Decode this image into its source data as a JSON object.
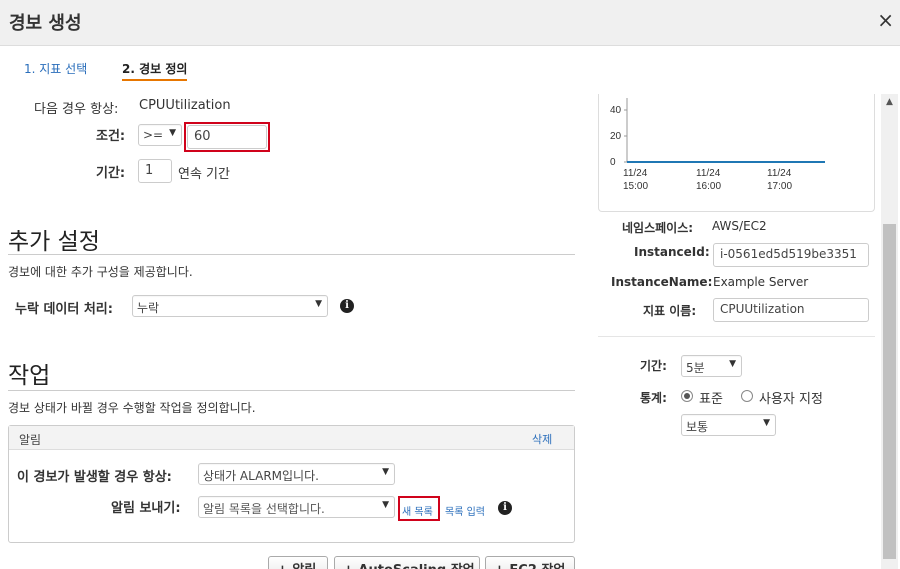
{
  "dialog": {
    "title": "경보 생성",
    "close": "×"
  },
  "steps": [
    {
      "label": "1. 지표 선택"
    },
    {
      "label": "2. 경보 정의"
    }
  ],
  "alarm": {
    "whenever_label": "다음 경우 항상:",
    "whenever_value": "CPUUtilization",
    "condition_label": "조건:",
    "operator": ">=",
    "threshold": "60",
    "period_label": "기간:",
    "period_value": "1",
    "period_suffix": "연속 기간"
  },
  "additional": {
    "title": "추가 설정",
    "subtitle": "경보에 대한 추가 구성을 제공합니다.",
    "missing_label": "누락 데이터 처리:",
    "missing_value": "누락"
  },
  "actions": {
    "title": "작업",
    "subtitle": "경보 상태가 바뀔 경우 수행할 작업을 정의합니다.",
    "notification": {
      "header": "알림",
      "delete": "삭제",
      "whenever_label": "이 경보가 발생할 경우 항상:",
      "whenever_value": "상태가 ALARM입니다.",
      "send_label": "알림 보내기:",
      "send_placeholder": "알림 목록을 선택합니다.",
      "new_list": "새 목록",
      "enter_list": "목록 입력"
    },
    "buttons": [
      "+ 알림",
      "+ AutoScaling 작업",
      "+ EC2 작업"
    ]
  },
  "chart_data": {
    "type": "line",
    "x": [
      "11/24 15:00",
      "11/24 16:00",
      "11/24 17:00"
    ],
    "y_ticks": [
      0,
      20,
      40
    ],
    "series": [
      {
        "values": [
          0,
          0,
          0
        ]
      }
    ],
    "color": "#1f77b4",
    "x_tick_labels": [
      {
        "date": "11/24",
        "time": "15:00"
      },
      {
        "date": "11/24",
        "time": "16:00"
      },
      {
        "date": "11/24",
        "time": "17:00"
      }
    ]
  },
  "metric_info": {
    "namespace_label": "네임스페이스:",
    "namespace_value": "AWS/EC2",
    "instanceid_label": "InstanceId:",
    "instanceid_value": "i-0561ed5d519be3351",
    "instancename_label": "InstanceName:",
    "instancename_value": "Example Server",
    "metricname_label": "지표 이름:",
    "metricname_value": "CPUUtilization"
  },
  "stats": {
    "period_label": "기간:",
    "period_value": "5분",
    "statistic_label": "통계:",
    "standard": "표준",
    "custom": "사용자 지정",
    "statistic_value": "보통"
  }
}
